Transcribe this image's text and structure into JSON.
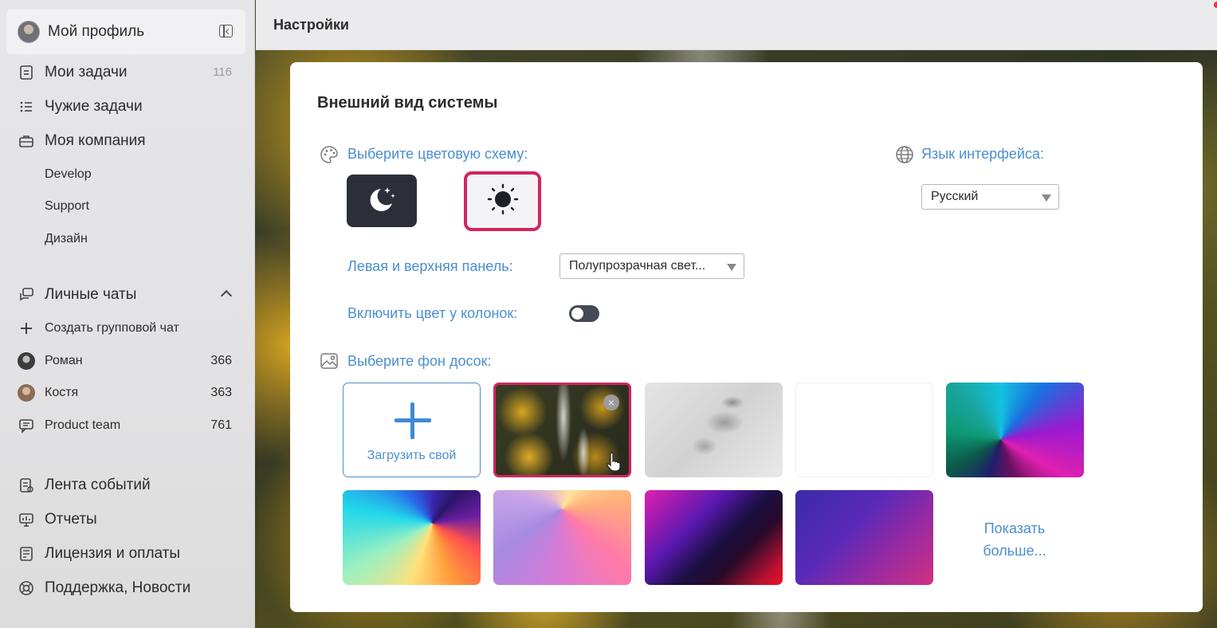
{
  "sidebar": {
    "profile_name": "Мой профиль",
    "nav": [
      {
        "label": "Мои задачи",
        "count": "116"
      },
      {
        "label": "Чужие задачи"
      },
      {
        "label": "Моя компания"
      }
    ],
    "company_subitems": [
      "Develop",
      "Support",
      "Дизайн"
    ],
    "chats_header": "Личные чаты",
    "create_group_chat": "Создать групповой чат",
    "chats": [
      {
        "name": "Роман",
        "count": "366"
      },
      {
        "name": "Костя",
        "count": "363"
      },
      {
        "name": "Product team",
        "count": "761"
      }
    ],
    "bottom_nav": [
      {
        "label": "Лента событий"
      },
      {
        "label": "Отчеты"
      },
      {
        "label": "Лицензия и оплаты"
      },
      {
        "label": "Поддержка, Новости"
      }
    ]
  },
  "header": {
    "title": "Настройки"
  },
  "card": {
    "title": "Внешний вид системы",
    "color_scheme_label": "Выберите цветовую схему:",
    "schemes": [
      {
        "name": "dark",
        "icon": "moon-stars-icon",
        "selected": false
      },
      {
        "name": "light",
        "icon": "sun-icon",
        "selected": true
      }
    ],
    "language_label": "Язык интерфейса:",
    "language_value": "Русский",
    "panel_label": "Левая и верхняя панель:",
    "panel_value": "Полупрозрачная свет...",
    "column_color_label": "Включить цвет у колонок:",
    "column_color_enabled": false,
    "background_label": "Выберите фон досок:",
    "upload_label": "Загрузить свой",
    "show_more_line1": "Показать",
    "show_more_line2": "больше..."
  },
  "colors": {
    "accent_blue": "#4a8fd0",
    "selected_border": "#d3245e",
    "dark_scheme": "#2c2f38",
    "toggle_off": "#434a55"
  }
}
